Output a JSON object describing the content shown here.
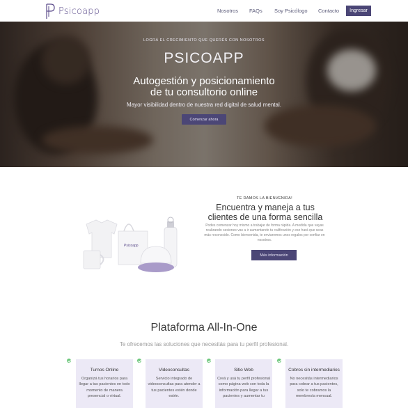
{
  "nav": {
    "logo_text": "Psicoapp",
    "links": [
      "Nosotros",
      "FAQs",
      "Soy Psicólogo",
      "Contacto"
    ],
    "cta": "Ingresar"
  },
  "hero": {
    "eyebrow": "LOGRÁ EL CRECIMIENTO QUE QUERÉS CON NOSOTROS",
    "title": "PSICOAPP",
    "subtitle_line1": "Autogestión y posicionamiento",
    "subtitle_line2": "de tu consultorio online",
    "tagline": "Mayor visibilidad dentro de nuestra red digital de salud mental.",
    "button": "Comenzar ahora"
  },
  "welcome": {
    "eyebrow": "TE DAMOS LA BIENVENIDA!",
    "title_line1": "Encuentra y maneja a tus",
    "title_line2": "clientes de una forma sencilla",
    "body": "Podes comenzar hoy mismo a trabajar de forma rápida. A medida que vayas realizando sesiones vas a ir aumentando tu calificación y eso hará que seas más reconocido. Como bienvenida, te enviaremos unos regalos por confiar en nosotros.",
    "button": "Más información",
    "merch_brand": "Psicoapp"
  },
  "platform": {
    "title": "Plataforma All-In-One",
    "subtitle": "Te ofrecemos las soluciones que necesitás para tu perfil profesional.",
    "cards": [
      {
        "title": "Turnos Online",
        "text": "Organizá tus horarios para llegar a tus pacientes en todo momento de manera presencial o virtual."
      },
      {
        "title": "Videoconsultas",
        "text": "Servicio integrado de videoconsultas para atender a tus pacientes estén donde estén."
      },
      {
        "title": "Sitio Web",
        "text": "Creá y usá tu perfil profesional como página web con toda la información para llegar a tus pacientes y aumentar tu"
      },
      {
        "title": "Cobros sin intermediarios",
        "text": "No necesitás intermediarios para cobrar a tus pacientes, solo te cobramos la membresía mensual."
      }
    ]
  },
  "colors": {
    "brand": "#4b4676",
    "card_bg": "#ece9f6",
    "check": "#6bc77a"
  }
}
